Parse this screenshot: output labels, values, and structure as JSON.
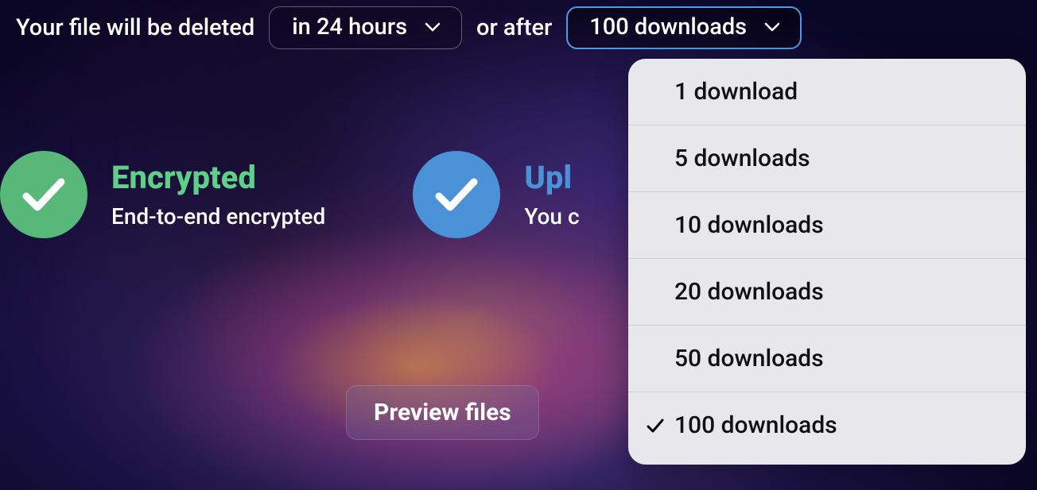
{
  "deletion": {
    "prefix": "Your file will be deleted",
    "time_selected": "in 24 hours",
    "conjunction": "or after",
    "downloads_selected": "100 downloads"
  },
  "downloads_menu": {
    "options": [
      {
        "label": "1 download",
        "selected": false
      },
      {
        "label": "5 downloads",
        "selected": false
      },
      {
        "label": "10 downloads",
        "selected": false
      },
      {
        "label": "20 downloads",
        "selected": false
      },
      {
        "label": "50 downloads",
        "selected": false
      },
      {
        "label": "100 downloads",
        "selected": true
      }
    ]
  },
  "features": {
    "encrypted": {
      "title": "Encrypted",
      "subtitle": "End-to-end encrypted"
    },
    "uploaded": {
      "title": "Upl",
      "subtitle": "You c"
    }
  },
  "preview_button": "Preview files"
}
